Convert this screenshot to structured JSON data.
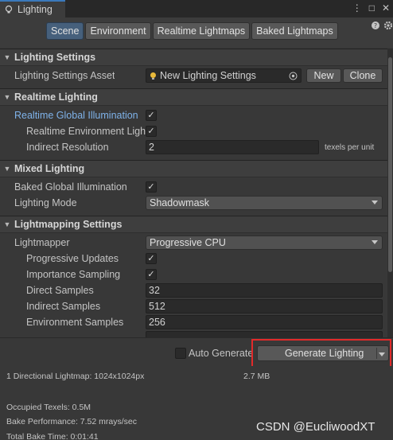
{
  "window": {
    "tab_title": "Lighting",
    "controls": [
      "⋮",
      "□",
      "✕"
    ]
  },
  "toolbar": {
    "tabs": [
      {
        "label": "Scene",
        "active": true
      },
      {
        "label": "Environment",
        "active": false
      },
      {
        "label": "Realtime Lightmaps",
        "active": false
      },
      {
        "label": "Baked Lightmaps",
        "active": false
      }
    ],
    "side_icons": [
      "help-icon",
      "settings-icon"
    ]
  },
  "lighting_settings": {
    "header": "Lighting Settings",
    "asset_label": "Lighting Settings Asset",
    "asset_value": "New Lighting Settings",
    "new_button": "New",
    "clone_button": "Clone"
  },
  "realtime_lighting": {
    "header": "Realtime Lighting",
    "rgi_label": "Realtime Global Illumination",
    "rgi_checked": true,
    "env_label": "Realtime Environment Ligh",
    "env_checked": true,
    "indirect_res_label": "Indirect Resolution",
    "indirect_res_value": "2",
    "indirect_res_unit": "texels per unit"
  },
  "mixed_lighting": {
    "header": "Mixed Lighting",
    "bgi_label": "Baked Global Illumination",
    "bgi_checked": true,
    "mode_label": "Lighting Mode",
    "mode_value": "Shadowmask"
  },
  "lightmapping_settings": {
    "header": "Lightmapping Settings",
    "lightmapper_label": "Lightmapper",
    "lightmapper_value": "Progressive CPU",
    "progressive_updates_label": "Progressive Updates",
    "progressive_updates_checked": true,
    "importance_sampling_label": "Importance Sampling",
    "importance_sampling_checked": true,
    "direct_samples_label": "Direct Samples",
    "direct_samples_value": "32",
    "indirect_samples_label": "Indirect Samples",
    "indirect_samples_value": "512",
    "environment_samples_label": "Environment Samples",
    "environment_samples_value": "256"
  },
  "bake": {
    "auto_generate_label": "Auto Generate",
    "auto_generate_checked": false,
    "generate_button": "Generate Lighting"
  },
  "stats": {
    "lightmap": "1 Directional Lightmap: 1024x1024px",
    "lightmap_size": "2.7 MB",
    "occupied": "Occupied Texels: 0.5M",
    "performance": "Bake Performance: 7.52 mrays/sec",
    "total_time": "Total Bake Time: 0:01:41"
  },
  "watermark": "CSDN @EucliwoodXT",
  "colors": {
    "accent_tab": "#3a79bb",
    "link_label": "#7fb3ea",
    "active_tab": "#46607c",
    "highlight_box": "#e22a2a"
  }
}
